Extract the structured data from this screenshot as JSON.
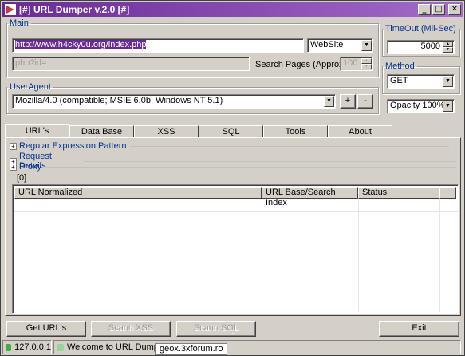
{
  "window": {
    "title": "[#] URL Dumper v.2.0 [#]",
    "controls": {
      "minimize": "_",
      "maximize": "□",
      "close": "✕"
    }
  },
  "main": {
    "legend": "Main",
    "url_value": "http://www.h4cky0u.org/index.php",
    "mode_value": "WebSite",
    "param_placeholder": "php?id=",
    "search_pages_label": "Search Pages (Approx.)",
    "search_pages_value": "100"
  },
  "timeout": {
    "legend": "TimeOut (Mil-Sec)",
    "value": "5000"
  },
  "method": {
    "legend": "Method",
    "value": "GET"
  },
  "useragent": {
    "legend": "UserAgent",
    "value": "Mozilla/4.0 (compatible; MSIE 6.0b; Windows NT 5.1)",
    "add_label": "+",
    "remove_label": "-"
  },
  "opacity": {
    "value": "Opacity 100%"
  },
  "tabs": [
    {
      "label": "URL's",
      "active": true
    },
    {
      "label": "Data Base",
      "active": false
    },
    {
      "label": "XSS",
      "active": false
    },
    {
      "label": "SQL",
      "active": false
    },
    {
      "label": "Tools",
      "active": false
    },
    {
      "label": "About",
      "active": false
    }
  ],
  "panel": {
    "sections": [
      {
        "label": "Regular Expression Pattern"
      },
      {
        "label": "Request Details"
      },
      {
        "label": "Proxy"
      }
    ],
    "count": "[0]",
    "columns": [
      "URL Normalized",
      "URL Base/Search Index",
      "Status"
    ]
  },
  "buttons": {
    "get_urls": "Get URL's",
    "scann_xss": "Scann XSS",
    "scann_sql": "Scann SQL",
    "exit": "Exit"
  },
  "statusbar": {
    "ip": "127.0.0.1",
    "message": "Welcome to URL Dumper",
    "watermark": "geox.3xforum.ro"
  },
  "colors": {
    "title_start": "#6a2a96",
    "title_end": "#a26bc9",
    "legend": "#003399",
    "selection": "#6a2a96",
    "led_green": "#3cb043"
  }
}
